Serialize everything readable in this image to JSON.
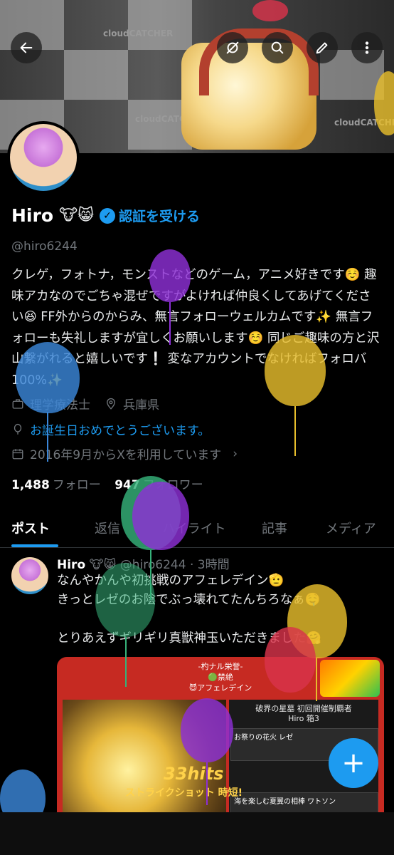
{
  "banner": {
    "brand_left": "cloudCATCHER",
    "brand_center": "cloudCATCHER",
    "brand_right": "cloudCATCHER"
  },
  "toolbar": {
    "back_icon": "arrow-left-icon",
    "grok_icon": "grok-icon",
    "search_icon": "search-icon",
    "edit_icon": "pencil-icon",
    "more_icon": "more-vertical-icon"
  },
  "profile": {
    "name": "Hiro",
    "name_emojis": "🐮😸",
    "verify_label": "認証を受ける",
    "handle": "@hiro6244",
    "bio": "クレゲ，フォトナ，モンストなどのゲーム，アニメ好きです☺️ 趣味アカなのでごちゃ混ぜですがよければ仲良くしてあげてください😆 FF外からのからみ、無言フォローウェルカムです✨ 無言フォローも失礼しますが宜しくお願いします☺️ 同じご趣味の方と沢山繋がれると嬉しいです❕ 変なアカウントでなければフォロバ100%✨",
    "job": "理学療法士",
    "location": "兵庫県",
    "birthday": "お誕生日おめでとうございます。",
    "joined": "2016年9月からXを利用しています",
    "following_count": "1,488",
    "following_label": "フォロー",
    "followers_count": "947",
    "followers_label": "フォロワー"
  },
  "tabs": [
    "ポスト",
    "返信",
    "ハイライト",
    "記事",
    "メディア"
  ],
  "post": {
    "author": "Hiro",
    "author_emojis": "🐮😸",
    "meta": "@hiro6244 · 3時間",
    "text_line1": "なんやかんや初挑戦のアフェレデイン🫡",
    "text_line2": "きっとレゼのお陰でぶっ壊れてたんちろなぁ🤤",
    "text_line3": "とりあえずギリギリ真獣神玉いただきました🤗",
    "card": {
      "title_line1": "-杓ナル栄誉-",
      "title_line2": "🟢禁絶",
      "title_line3": "😈アフェレデイン",
      "boss_header": "破界の星墓 初回開催制覇者",
      "boss_name": "Hiro 箱3",
      "row1_name": "お祭りの花火 レゼ",
      "row2_name": "海を楽しむ夏翼の相棒 ワトソン",
      "hits": "33hits",
      "strike": "ストライクショット 時短!"
    }
  },
  "fab": {
    "label": "+",
    "icon": "plus-icon"
  },
  "colors": {
    "accent": "#1d9bf0",
    "background": "#000000",
    "muted": "#71767b"
  }
}
